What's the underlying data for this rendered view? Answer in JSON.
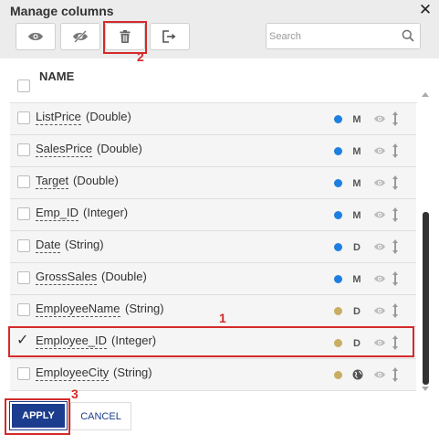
{
  "dialog": {
    "title": "Manage columns",
    "close_label": "✕"
  },
  "toolbar": {
    "buttons": [
      {
        "icon": "eye-icon"
      },
      {
        "icon": "eye-slash-icon"
      },
      {
        "icon": "trash-icon"
      },
      {
        "icon": "exit-icon"
      }
    ],
    "search_placeholder": "Search"
  },
  "header": {
    "label": "NAME"
  },
  "columns": [
    {
      "name": "ListPrice",
      "type": "(Double)",
      "kind": "M",
      "dot_color": "#1e7fe0",
      "checked": false
    },
    {
      "name": "SalesPrice",
      "type": "(Double)",
      "kind": "M",
      "dot_color": "#1e7fe0",
      "checked": false
    },
    {
      "name": "Target",
      "type": "(Double)",
      "kind": "M",
      "dot_color": "#1e7fe0",
      "checked": false
    },
    {
      "name": "Emp_ID",
      "type": "(Integer)",
      "kind": "M",
      "dot_color": "#1e7fe0",
      "checked": false
    },
    {
      "name": "Date",
      "type": "(String)",
      "kind": "D",
      "dot_color": "#1e7fe0",
      "checked": false
    },
    {
      "name": "GrossSales",
      "type": "(Double)",
      "kind": "M",
      "dot_color": "#1e7fe0",
      "checked": false
    },
    {
      "name": "EmployeeName",
      "type": "(String)",
      "kind": "D",
      "dot_color": "#c9ad62",
      "checked": false
    },
    {
      "name": "Employee_ID",
      "type": "(Integer)",
      "kind": "D",
      "dot_color": "#c9ad62",
      "checked": true
    },
    {
      "name": "EmployeeCity",
      "type": "(String)",
      "kind": "globe",
      "dot_color": "#c9ad62",
      "checked": false
    }
  ],
  "markers": {
    "one": "1",
    "two": "2",
    "three": "3"
  },
  "footer": {
    "apply_label": "APPLY",
    "cancel_label": "CANCEL"
  },
  "colors": {
    "accent": "#1c3d8e",
    "highlight": "#d42a2a",
    "measure_dot": "#1e7fe0",
    "dimension_dot": "#c9ad62"
  }
}
